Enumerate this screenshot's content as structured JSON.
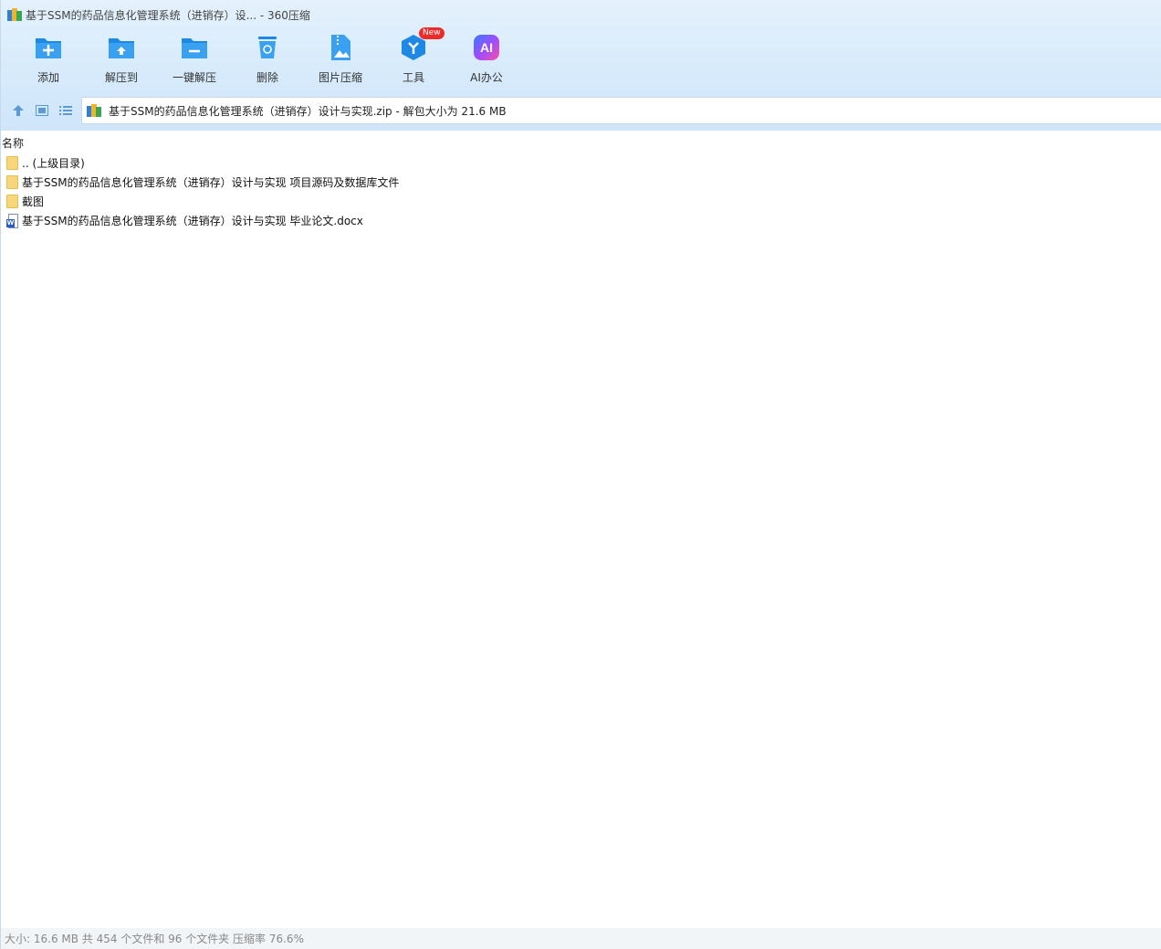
{
  "window": {
    "title": "基于SSM的药品信息化管理系统（进销存）设... - 360压缩"
  },
  "toolbar": {
    "items": [
      {
        "label": "添加",
        "icon": "add-icon"
      },
      {
        "label": "解压到",
        "icon": "extract-to-icon"
      },
      {
        "label": "一键解压",
        "icon": "one-click-extract-icon"
      },
      {
        "label": "删除",
        "icon": "delete-icon"
      },
      {
        "label": "图片压缩",
        "icon": "image-compress-icon"
      },
      {
        "label": "工具",
        "icon": "tools-icon",
        "badge": "New"
      },
      {
        "label": "AI办公",
        "icon": "ai-office-icon",
        "icon_text": "AI"
      }
    ]
  },
  "address": {
    "text": "基于SSM的药品信息化管理系统（进销存）设计与实现.zip - 解包大小为 21.6 MB"
  },
  "list": {
    "column_name": "名称",
    "items": [
      {
        "name": ".. (上级目录)",
        "type": "folder"
      },
      {
        "name": "基于SSM的药品信息化管理系统（进销存）设计与实现 项目源码及数据库文件",
        "type": "folder"
      },
      {
        "name": "截图",
        "type": "folder"
      },
      {
        "name": "基于SSM的药品信息化管理系统（进销存）设计与实现 毕业论文.docx",
        "type": "docx",
        "icon_text": "W"
      }
    ]
  },
  "status": {
    "text": "大小: 16.6 MB 共 454 个文件和 96 个文件夹 压缩率 76.6%"
  },
  "colors": {
    "accent": "#1e88e5",
    "toolbar_bg": "#d6eafb",
    "badge": "#ee2b2b",
    "folder": "#f6d77b"
  }
}
